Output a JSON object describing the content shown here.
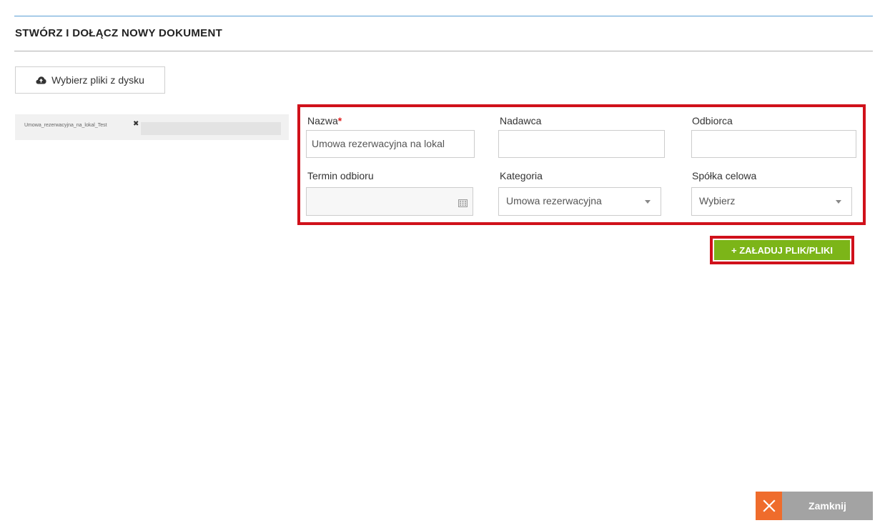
{
  "dialog": {
    "title": "STWÓRZ I DOŁĄCZ NOWY DOKUMENT",
    "accent_color": "#5a9fd4"
  },
  "upload": {
    "button_label": "Wybierz pliki z dysku",
    "icon": "cloud-upload-icon"
  },
  "files": [
    {
      "name": "Umowa_rezerwacyjna_na_lokal_Test",
      "remove_icon": "close-icon"
    }
  ],
  "form": {
    "highlight_color": "#d0111b",
    "name": {
      "label": "Nazwa",
      "required_mark": "*",
      "value": "Umowa rezerwacyjna na lokal"
    },
    "sender": {
      "label": "Nadawca",
      "value": ""
    },
    "recipient": {
      "label": "Odbiorca",
      "value": ""
    },
    "due_date": {
      "label": "Termin odbioru",
      "value": "",
      "icon": "calendar-icon"
    },
    "category": {
      "label": "Kategoria",
      "selected": "Umowa rezerwacyjna"
    },
    "company": {
      "label": "Spółka celowa",
      "selected": "Wybierz"
    }
  },
  "actions": {
    "load_label": "+ ZAŁADUJ PLIK/PLIKI",
    "load_color": "#7cb518",
    "close_label": "Zamknij",
    "close_icon": "close-icon",
    "close_icon_color": "#ef6c2c"
  }
}
